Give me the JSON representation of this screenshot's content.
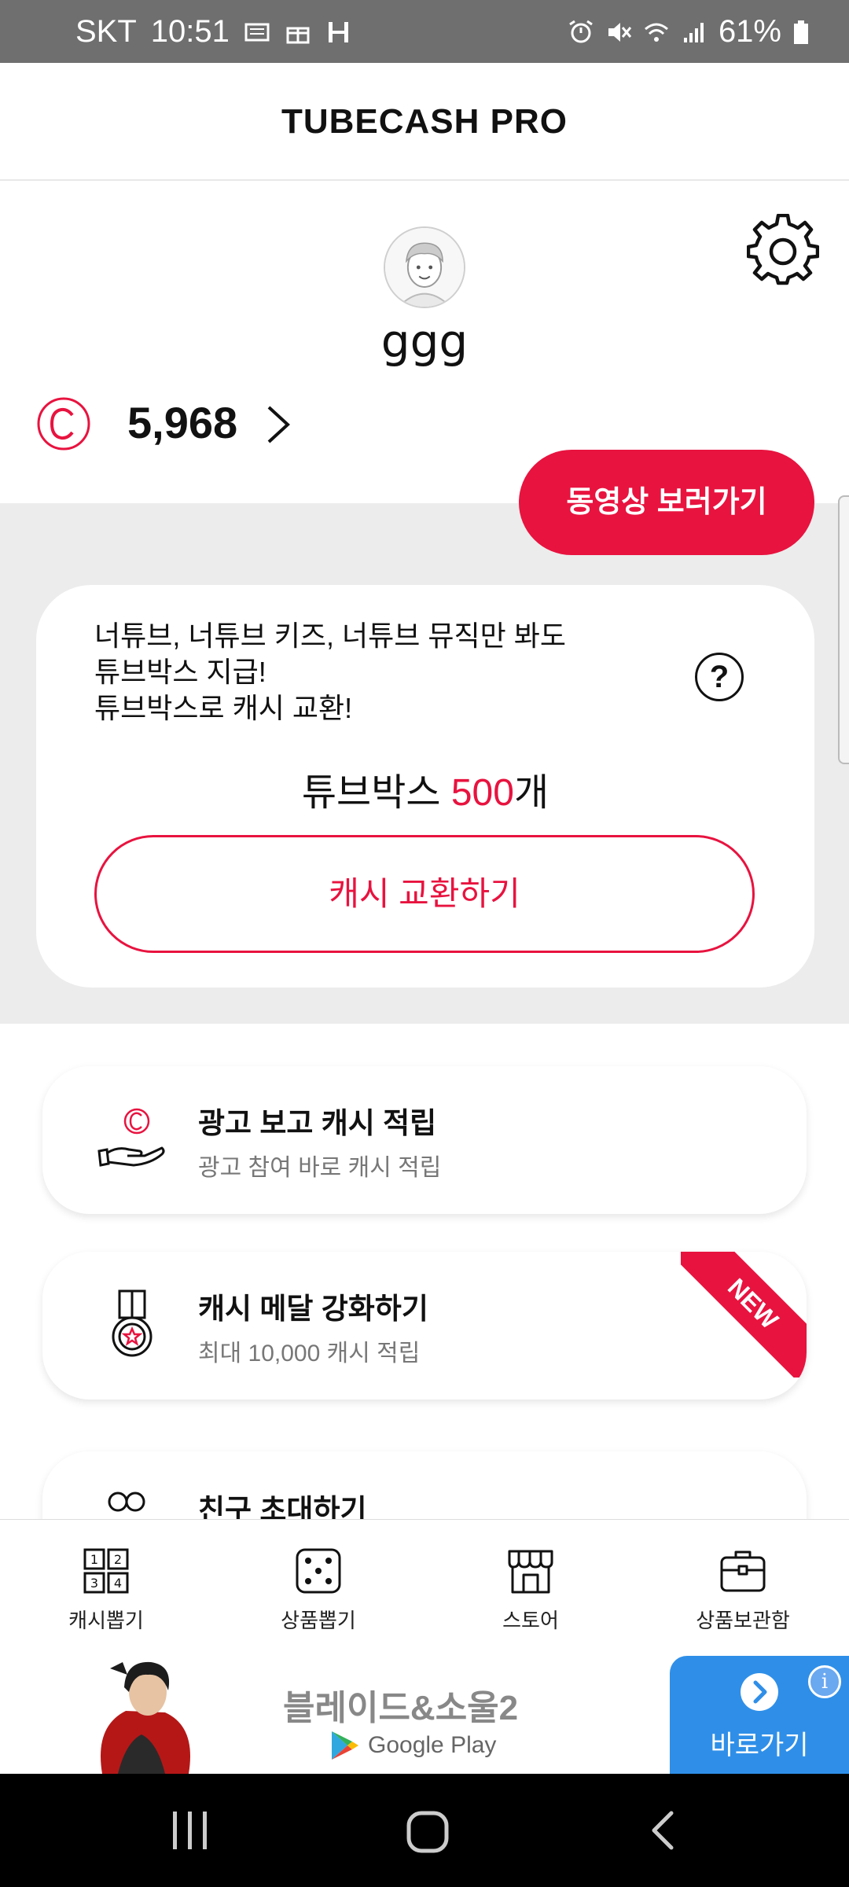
{
  "status_bar": {
    "carrier": "SKT",
    "time": "10:51",
    "battery": "61%"
  },
  "header": {
    "title": "TUBECASH PRO"
  },
  "profile": {
    "username": "ggg",
    "cash_balance": "5,968",
    "watch_button": "동영상 보러가기"
  },
  "tubebox": {
    "description_lines": [
      "너튜브, 너튜브 키즈, 너튜브 뮤직만 봐도",
      "튜브박스 지급!",
      "튜브박스로 캐시 교환!"
    ],
    "help_label": "?",
    "count_prefix": "튜브박스 ",
    "count_value": "500",
    "count_suffix": "개",
    "exchange_button": "캐시 교환하기"
  },
  "menu": [
    {
      "title": "광고 보고 캐시 적립",
      "subtitle": "광고 참여 바로 캐시 적립",
      "icon": "hand-coin-icon"
    },
    {
      "title": "캐시 메달 강화하기",
      "subtitle": "최대 10,000 캐시 적립",
      "icon": "medal-icon",
      "badge": "NEW"
    },
    {
      "title": "친구 초대하기",
      "icon": "friends-icon"
    }
  ],
  "bottom_nav": [
    {
      "label": "캐시뽑기",
      "icon": "number-grid-icon"
    },
    {
      "label": "상품뽑기",
      "icon": "dice-icon"
    },
    {
      "label": "스토어",
      "icon": "store-icon"
    },
    {
      "label": "상품보관함",
      "icon": "briefcase-icon"
    }
  ],
  "ad": {
    "title": "블레이드&소울2",
    "store": "Google Play",
    "cta": "바로가기",
    "info": "i"
  },
  "colors": {
    "accent": "#e8133f",
    "band": "#ececec",
    "ad_cta": "#2f8fe8"
  }
}
